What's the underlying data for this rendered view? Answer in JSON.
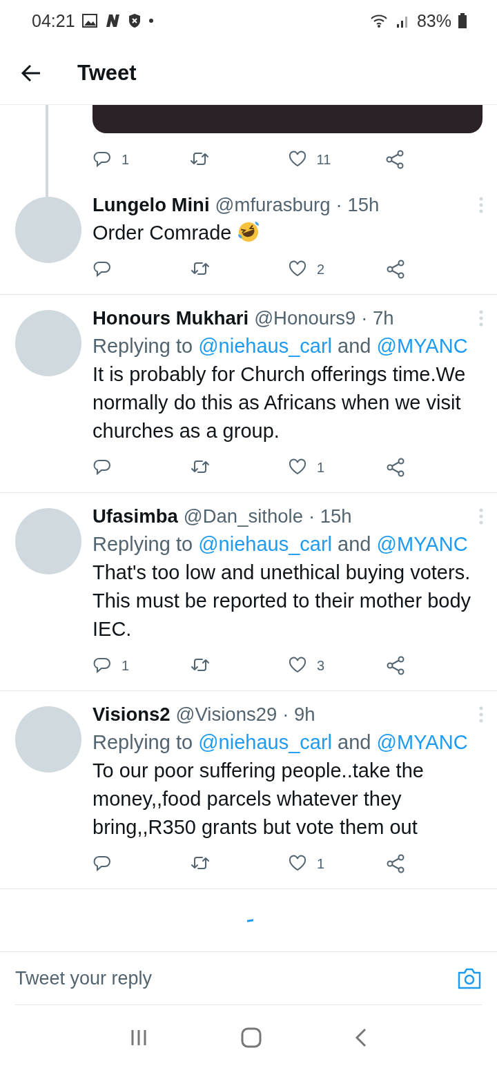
{
  "status_bar": {
    "time": "04:21",
    "battery": "83%"
  },
  "header": {
    "title": "Tweet"
  },
  "top_tweet": {
    "actions": {
      "replies": "1",
      "likes": "11"
    }
  },
  "replies": [
    {
      "name": "Lungelo Mini",
      "handle": "@mfurasburg",
      "time": "· 15h",
      "text": "Order Comrade",
      "emoji": true,
      "actions": {
        "likes": "2"
      }
    },
    {
      "name": "Honours Mukhari",
      "handle": "@Honours9",
      "time": "· 7h",
      "replying_to": [
        {
          "text": "Replying to",
          "link": false
        },
        {
          "text": "@niehaus_carl",
          "link": true
        },
        {
          "text": "and",
          "link": false
        },
        {
          "text": "@MYANC",
          "link": true
        }
      ],
      "text": "It is probably for Church offerings time.We normally do this as Africans when we visit churches as a group.",
      "actions": {
        "likes": "1"
      }
    },
    {
      "name": "Ufasimba",
      "handle": "@Dan_sithole",
      "time": "· 15h",
      "replying_to": [
        {
          "text": "Replying to",
          "link": false
        },
        {
          "text": "@niehaus_carl",
          "link": true
        },
        {
          "text": "and",
          "link": false
        },
        {
          "text": "@MYANC",
          "link": true
        }
      ],
      "text": "That's too low and unethical buying voters. This must be reported to their mother body IEC.",
      "actions": {
        "replies": "1",
        "likes": "3"
      }
    },
    {
      "name": "Visions2",
      "handle": "@Visions29",
      "time": "· 9h",
      "replying_to": [
        {
          "text": "Replying to",
          "link": false
        },
        {
          "text": "@niehaus_carl",
          "link": true
        },
        {
          "text": "and",
          "link": false
        },
        {
          "text": "@MYANC",
          "link": true
        }
      ],
      "text": "To our poor suffering people..take the money,,food parcels whatever they bring,,R350 grants but vote them out",
      "actions": {
        "likes": "1"
      }
    }
  ],
  "reply_field": {
    "placeholder": "Tweet your reply"
  }
}
